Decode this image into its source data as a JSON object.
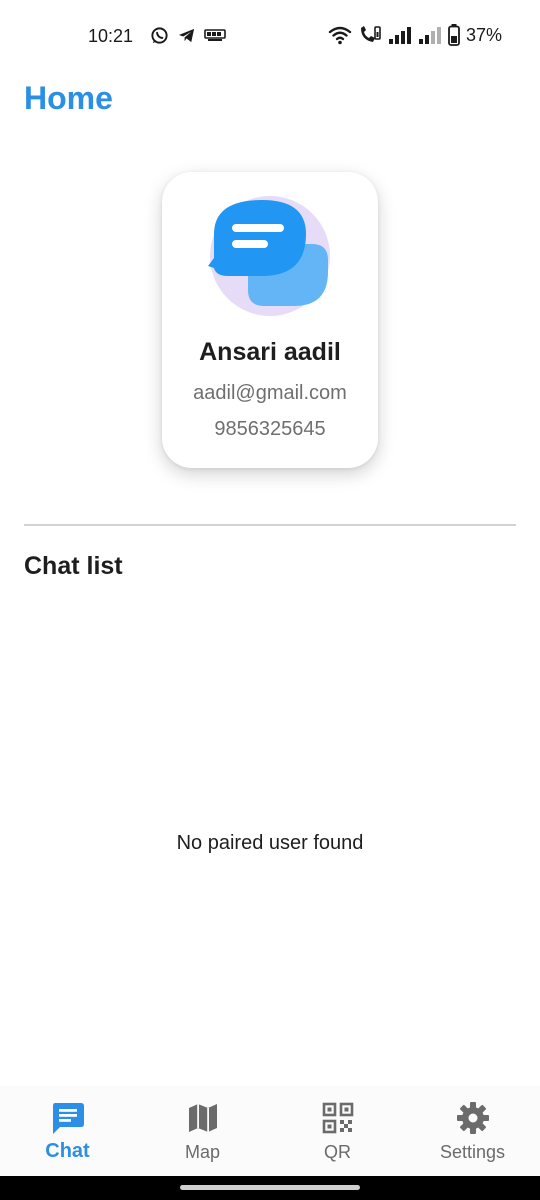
{
  "status_bar": {
    "time": "10:21",
    "battery": "37%",
    "left_icons": [
      "whatsapp-icon",
      "telegram-icon",
      "news-app-icon"
    ],
    "right_icons": [
      "wifi-icon",
      "call-icon",
      "signal-icon",
      "signal-weak-icon",
      "battery-icon"
    ]
  },
  "header": {
    "title": "Home"
  },
  "profile": {
    "name": "Ansari aadil",
    "email": "aadil@gmail.com",
    "phone": "9856325645",
    "avatar_icon": "chat-bubble-logo-icon"
  },
  "chat_list": {
    "title": "Chat list",
    "empty_message": "No paired user found"
  },
  "bottom_nav": {
    "items": [
      {
        "label": "Chat",
        "icon": "chat-icon",
        "active": true
      },
      {
        "label": "Map",
        "icon": "map-icon",
        "active": false
      },
      {
        "label": "QR",
        "icon": "qr-code-icon",
        "active": false
      },
      {
        "label": "Settings",
        "icon": "gear-icon",
        "active": false
      }
    ]
  },
  "colors": {
    "accent": "#2b8fe6",
    "text": "#1e1e1e",
    "muted": "#6f6f6f",
    "nav_inactive": "#6b6b6b",
    "avatar_bubble_front": "#2196f3",
    "avatar_bubble_back": "#64b5f6",
    "avatar_background": "#e6dcf8"
  }
}
